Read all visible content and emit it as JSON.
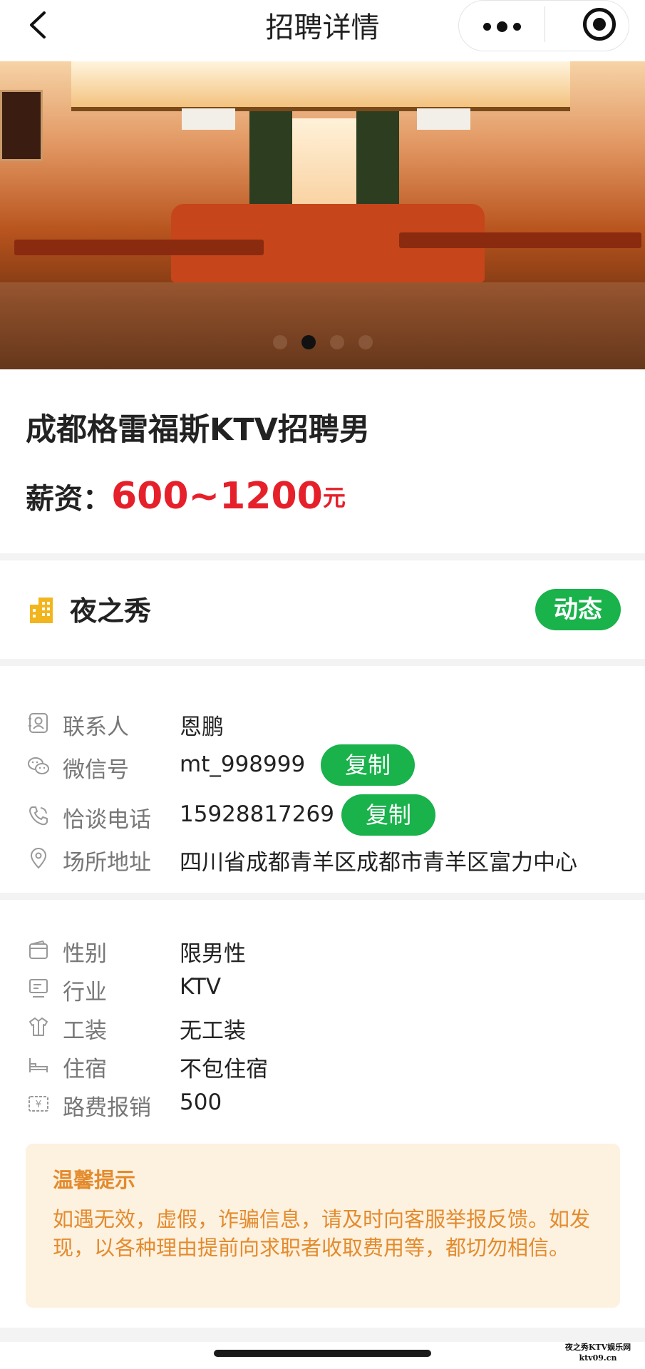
{
  "header": {
    "title": "招聘详情"
  },
  "banner": {
    "slide_count": 4,
    "active_slide": 2
  },
  "job": {
    "title": "成都格雷福斯KTV招聘男",
    "salary_label": "薪资：",
    "salary_value": "600~1200",
    "salary_unit": "元"
  },
  "company": {
    "name": "夜之秀",
    "dynamic_label": "动态",
    "icon": "building-icon"
  },
  "contact": {
    "person_label": "联系人",
    "person_value": "恩鹏",
    "wechat_label": "微信号",
    "wechat_value": "mt_998999",
    "phone_label": "恰谈电话",
    "phone_value": "15928817269",
    "address_label": "场所地址",
    "address_value": "四川省成都青羊区成都市青羊区富力中心",
    "copy_label": "复制"
  },
  "details": {
    "gender_label": "性别",
    "gender_value": "限男性",
    "industry_label": "行业",
    "industry_value": "KTV",
    "uniform_label": "工装",
    "uniform_value": "无工装",
    "lodging_label": "住宿",
    "lodging_value": "不包住宿",
    "travel_label": "路费报销",
    "travel_value": "500"
  },
  "tip": {
    "title": "温馨提示",
    "text": "如遇无效，虚假，诈骗信息，请及时向客服举报反馈。如发现，以各种理由提前向求职者收取费用等，都切勿相信。"
  },
  "watermark": {
    "line1": "夜之秀KTV娱乐网",
    "line2": "ktv09.cn"
  },
  "colors": {
    "accent_green": "#19b24b",
    "salary_red": "#e6202a",
    "tip_orange": "#e38b2d",
    "tip_bg": "#fdf1e0",
    "company_icon": "#f2b51d"
  }
}
